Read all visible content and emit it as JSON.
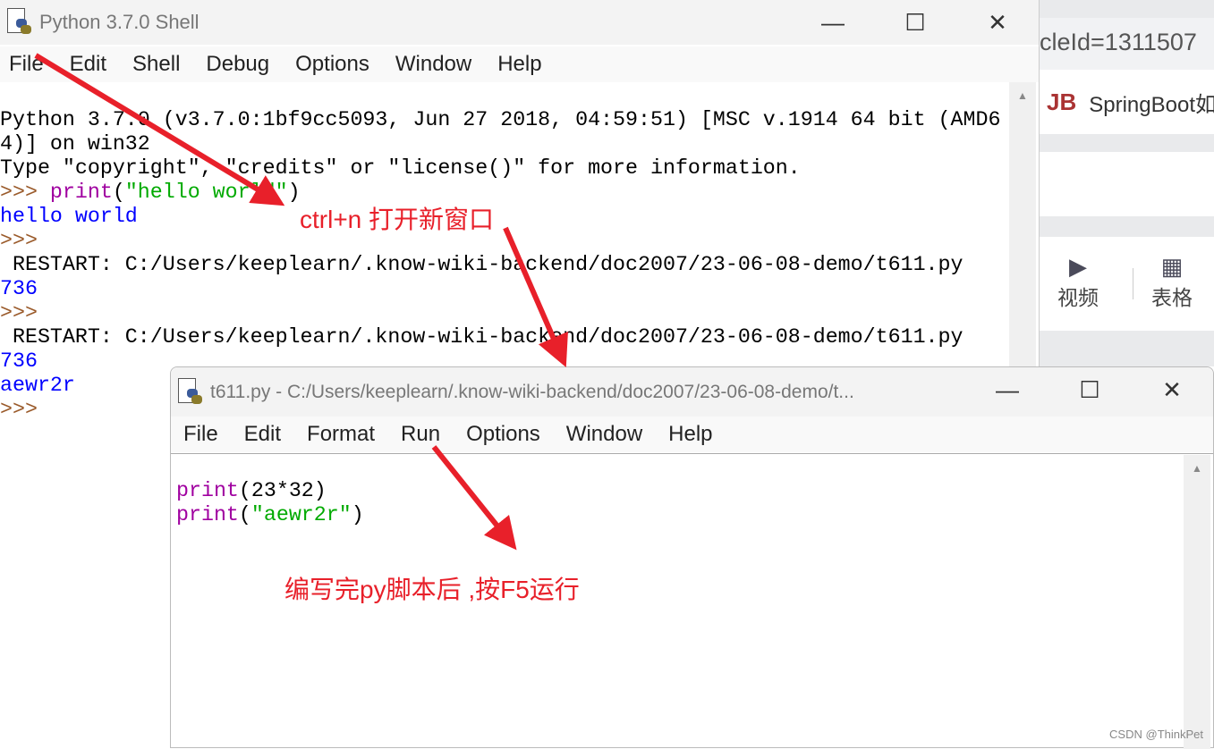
{
  "browser": {
    "url_fragment": "cleId=1311507",
    "tab_title": "SpringBoot如",
    "tools": [
      {
        "label": "视频",
        "icon": "video-icon"
      },
      {
        "label": "表格",
        "icon": "table-icon"
      }
    ]
  },
  "shell": {
    "title": "Python 3.7.0 Shell",
    "menu": [
      "File",
      "Edit",
      "Shell",
      "Debug",
      "Options",
      "Window",
      "Help"
    ],
    "lines": {
      "l1": "Python 3.7.0 (v3.7.0:1bf9cc5093, Jun 27 2018, 04:59:51) [MSC v.1914 64 bit (AMD6",
      "l2": "4)] on win32",
      "l3": "Type \"copyright\", \"credits\" or \"license()\" for more information.",
      "prompt": ">>> ",
      "l4_kw": "print",
      "l4_p1": "(",
      "l4_str": "\"hello world\"",
      "l4_p2": ")",
      "l5": "hello world",
      "l6": ">>>",
      "l7": " RESTART: C:/Users/keeplearn/.know-wiki-backend/doc2007/23-06-08-demo/t611.py",
      "l8": "736",
      "l9": ">>>",
      "l10": " RESTART: C:/Users/keeplearn/.know-wiki-backend/doc2007/23-06-08-demo/t611.py",
      "l11": "736",
      "l12": "aewr2r",
      "l13": ">>>"
    }
  },
  "editor": {
    "title": "t611.py - C:/Users/keeplearn/.know-wiki-backend/doc2007/23-06-08-demo/t...",
    "menu": [
      "File",
      "Edit",
      "Format",
      "Run",
      "Options",
      "Window",
      "Help"
    ],
    "code": {
      "c1_kw": "print",
      "c1_rest": "(23*32)",
      "c2_kw": "print",
      "c2_p1": "(",
      "c2_str": "\"aewr2r\"",
      "c2_p2": ")"
    }
  },
  "window_controls": {
    "minimize": "—",
    "maximize": "☐",
    "close": "✕"
  },
  "annotations": {
    "a1": "ctrl+n 打开新窗口",
    "a2": "编写完py脚本后 ,按F5运行"
  },
  "watermark": "CSDN @ThinkPet",
  "colors": {
    "annotation": "#e8202a",
    "keyword": "#a000a0",
    "string": "#00aa00",
    "output": "#0000ff",
    "prompt": "#9a5a2a"
  }
}
